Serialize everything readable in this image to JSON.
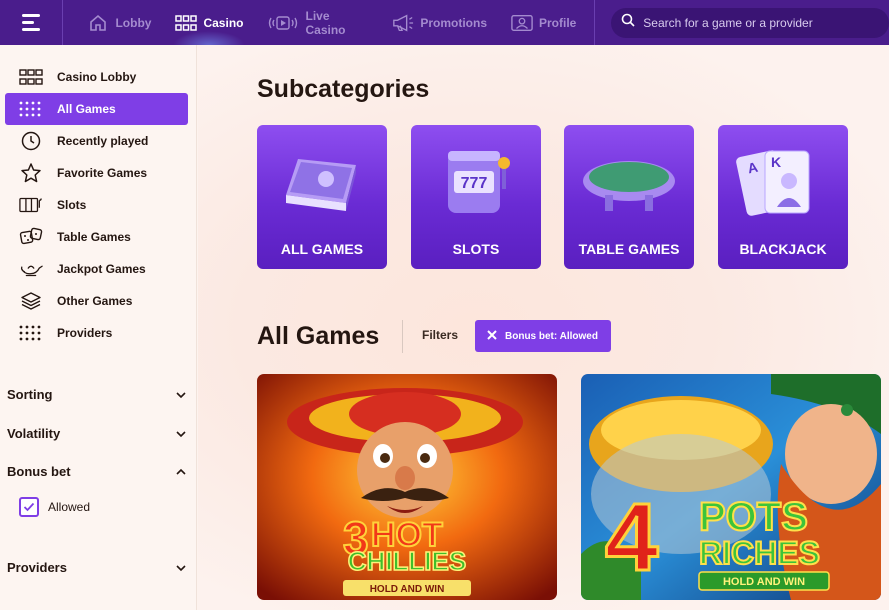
{
  "topbar": {
    "nav": [
      {
        "label": "Lobby",
        "icon": "home-icon"
      },
      {
        "label": "Casino",
        "icon": "grid-icon"
      },
      {
        "label": "Live Casino",
        "icon": "video-icon"
      },
      {
        "label": "Promotions",
        "icon": "megaphone-icon"
      },
      {
        "label": "Profile",
        "icon": "profile-icon"
      }
    ],
    "search_placeholder": "Search for a game or a provider"
  },
  "sidebar": {
    "items": [
      {
        "label": "Casino Lobby",
        "icon": "grid-icon"
      },
      {
        "label": "All Games",
        "icon": "dots-grid-icon",
        "active": true
      },
      {
        "label": "Recently played",
        "icon": "clock-icon"
      },
      {
        "label": "Favorite Games",
        "icon": "star-icon"
      },
      {
        "label": "Slots",
        "icon": "slots-icon"
      },
      {
        "label": "Table Games",
        "icon": "dice-icon"
      },
      {
        "label": "Jackpot Games",
        "icon": "lamp-icon"
      },
      {
        "label": "Other Games",
        "icon": "layers-icon"
      },
      {
        "label": "Providers",
        "icon": "dots-grid-icon"
      }
    ],
    "filters": {
      "sorting": "Sorting",
      "volatility": "Volatility",
      "bonus_bet": "Bonus bet",
      "bonus_option": "Allowed",
      "providers": "Providers"
    }
  },
  "main": {
    "subcategories_title": "Subcategories",
    "subcategories": [
      {
        "label": "ALL GAMES"
      },
      {
        "label": "SLOTS"
      },
      {
        "label": "TABLE GAMES"
      },
      {
        "label": "BLACKJACK"
      }
    ],
    "all_games_title": "All Games",
    "filters_label": "Filters",
    "active_filter": "Bonus bet: Allowed",
    "games": [
      {
        "line1": "3",
        "line2": "HOT",
        "line3": "CHILLIES",
        "tagline": "HOLD AND WIN"
      },
      {
        "line1": "4",
        "line2": "POTS",
        "line3": "RICHES",
        "tagline": "HOLD AND WIN"
      }
    ]
  },
  "colors": {
    "topbar": "#4a1d8c",
    "accent": "#7f3ee6",
    "background": "#fdf3ee"
  }
}
